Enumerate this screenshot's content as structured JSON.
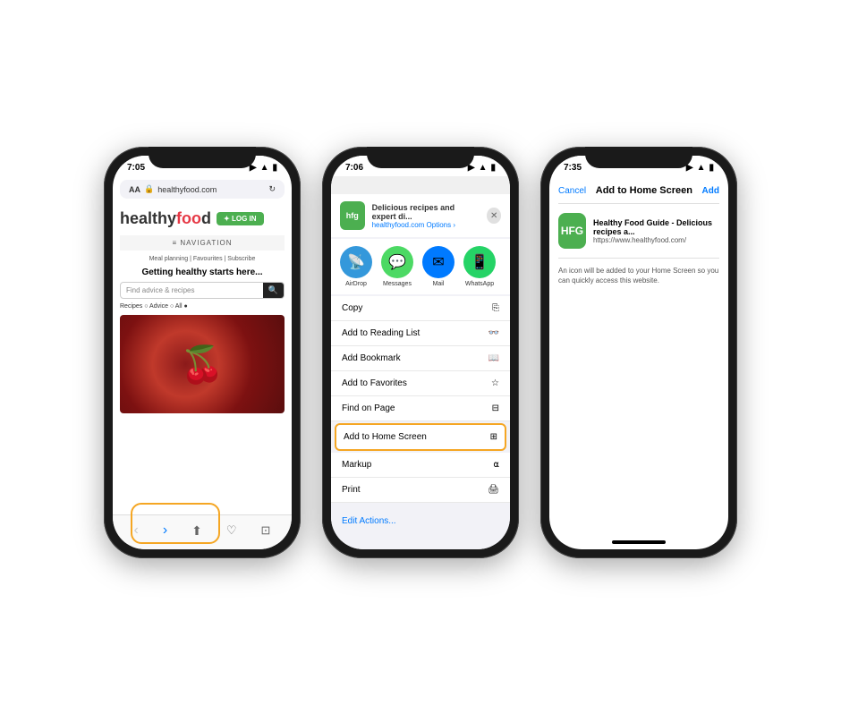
{
  "phone1": {
    "status": {
      "time": "7:05",
      "icons": "▶ ▲ ▮"
    },
    "url_bar": {
      "aa_label": "AA",
      "lock": "🔒",
      "url": "healthyfood.com",
      "refresh": "↻"
    },
    "site": {
      "logo_text": "healthyf",
      "logo_oo": "oo",
      "logo_d": "d",
      "login_btn": "✦ LOG IN",
      "nav": "≡  NAVIGATION",
      "nav_links": "Meal planning  |  Favourites  |  Subscribe",
      "hero_text": "Getting healthy starts here...",
      "search_placeholder": "Find advice & recipes",
      "radio_text": "Recipes ○ Advice ○ All ●"
    },
    "bottom": {
      "back": "‹",
      "forward": "›",
      "share": "⬆",
      "bookmark": "♡",
      "tabs": "⊡"
    }
  },
  "phone2": {
    "status": {
      "time": "7:06",
      "icons": "▶ ▲ ▮"
    },
    "share_header": {
      "app_icon": "hfg",
      "title": "Delicious recipes and expert di...",
      "url": "healthyfood.com  Options ›",
      "close": "✕"
    },
    "share_apps": [
      {
        "icon": "📡",
        "label": "AirDrop",
        "style": "airdrop"
      },
      {
        "icon": "💬",
        "label": "Messages",
        "style": "messages"
      },
      {
        "icon": "✉",
        "label": "Mail",
        "style": "mail"
      },
      {
        "icon": "📱",
        "label": "WhatsApp",
        "style": "whatsapp"
      }
    ],
    "menu_items": [
      {
        "label": "Copy",
        "icon": "⎘",
        "highlighted": false
      },
      {
        "label": "Add to Reading List",
        "icon": "👓",
        "highlighted": false
      },
      {
        "label": "Add Bookmark",
        "icon": "📖",
        "highlighted": false
      },
      {
        "label": "Add to Favorites",
        "icon": "☆",
        "highlighted": false
      },
      {
        "label": "Find on Page",
        "icon": "⊟",
        "highlighted": false
      },
      {
        "label": "Add to Home Screen",
        "icon": "⊞",
        "highlighted": true
      },
      {
        "label": "Markup",
        "icon": "⍺",
        "highlighted": false
      },
      {
        "label": "Print",
        "icon": "🖨",
        "highlighted": false
      }
    ],
    "edit_actions": "Edit Actions..."
  },
  "phone3": {
    "status": {
      "time": "7:35",
      "icons": "▶ ▲ ▮"
    },
    "add_home": {
      "cancel": "Cancel",
      "title": "Add to Home Screen",
      "add": "Add",
      "app_icon": "HFG",
      "app_name": "Healthy Food Guide - Delicious recipes a...",
      "app_url": "https://www.healthyfood.com/",
      "description": "An icon will be added to your Home Screen so you can quickly access this website."
    }
  }
}
